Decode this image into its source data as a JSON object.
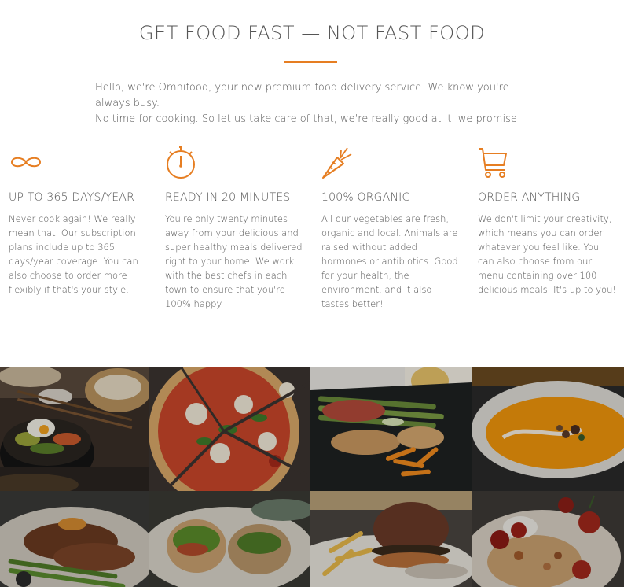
{
  "section": {
    "title": "GET FOOD FAST — NOT FAST FOOD",
    "intro_line1": "Hello, we're Omnifood, your new premium food delivery service. We know you're always busy.",
    "intro_line2": "No time for cooking. So let us take care of that, we're really good at it, we promise!"
  },
  "features": [
    {
      "icon": "infinity-icon",
      "title": "UP TO 365 DAYS/YEAR",
      "text": "Never cook again! We really mean that. Our subscription plans include up to 365 days/year coverage. You can also choose to order more flexibly if that's your style."
    },
    {
      "icon": "stopwatch-icon",
      "title": "READY IN 20 MINUTES",
      "text": "You're only twenty minutes away from your delicious and super healthy meals delivered right to your home. We work with the best chefs in each town to ensure that you're 100% happy."
    },
    {
      "icon": "carrot-icon",
      "title": "100% ORGANIC",
      "text": "All our vegetables are fresh, organic and local. Animals are raised without added hormones or antibiotics. Good for your health, the environment, and it also tastes better!"
    },
    {
      "icon": "cart-icon",
      "title": "ORDER ANYTHING",
      "text": "We don't limit your creativity, which means you can order whatever you feel like. You can also choose from our menu containing over 100 delicious meals. It's up to you!"
    }
  ],
  "colors": {
    "accent": "#e67e22",
    "text": "#555555"
  },
  "meals": [
    {
      "name": "korean-bibimbap-photo"
    },
    {
      "name": "pizza-photo"
    },
    {
      "name": "chicken-asparagus-photo"
    },
    {
      "name": "pumpkin-soup-photo"
    },
    {
      "name": "steak-photo"
    },
    {
      "name": "wrap-photo"
    },
    {
      "name": "burger-photo"
    },
    {
      "name": "granola-bowl-photo"
    }
  ]
}
